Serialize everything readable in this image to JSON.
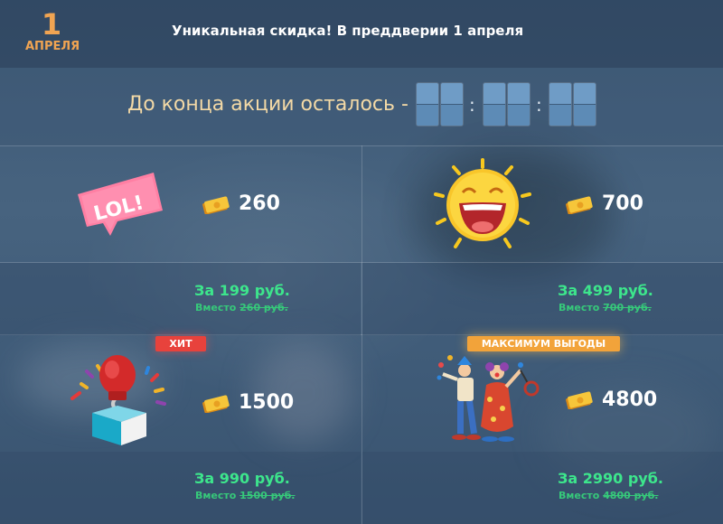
{
  "header": {
    "date_number": "1",
    "date_month": "АПРЕЛЯ",
    "title": "Уникальная скидка! В преддверии 1 апреля"
  },
  "timer": {
    "label": "До конца акции осталось -",
    "separator": ":"
  },
  "colors": {
    "accent_orange": "#f0a452",
    "price_green": "#3de68c",
    "ribbon_red": "#e8423c",
    "ribbon_gold": "#f2a33a",
    "digit_blue": "#6f9cc6"
  },
  "offers": [
    {
      "image": "lol-speech-bubble",
      "amount": "260",
      "price": "За 199 руб.",
      "old_prefix": "Вместо",
      "old_price": "260 руб.",
      "badge": ""
    },
    {
      "image": "laughing-sun-emoji",
      "amount": "700",
      "price": "За 499 руб.",
      "old_prefix": "Вместо",
      "old_price": "700 руб.",
      "badge": ""
    },
    {
      "image": "boxing-glove-jack-in-box",
      "amount": "1500",
      "price": "За 990 руб.",
      "old_prefix": "Вместо",
      "old_price": "1500 руб.",
      "badge": "ХИТ"
    },
    {
      "image": "clowns-juggling",
      "amount": "4800",
      "price": "За 2990 руб.",
      "old_prefix": "Вместо",
      "old_price": "4800 руб.",
      "badge": "МАКСИМУМ ВЫГОДЫ"
    }
  ],
  "icons": {
    "currency": "coin-bill-icon"
  }
}
